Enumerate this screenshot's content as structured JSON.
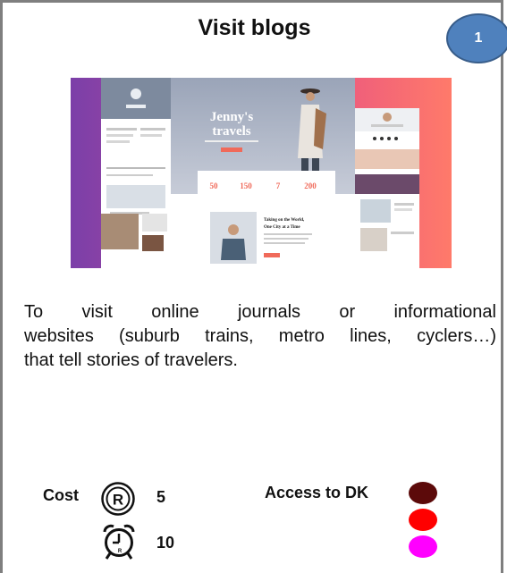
{
  "card": {
    "number": "1",
    "title": "Visit blogs",
    "description_lines": [
      "To visit online journals or informational",
      "websites (suburb trains, metro lines, cyclers…)",
      "that tell stories of travelers."
    ],
    "cost_label": "Cost",
    "cost_value": "5",
    "time_value": "10",
    "access_label": "Access to DK",
    "access_colors": [
      "#5c0a0a",
      "#ff0000",
      "#ff00ff"
    ]
  },
  "screenshot": {
    "hero_title_line1": "Jenny's",
    "hero_title_line2": "travels",
    "stats": [
      "50",
      "150",
      "7",
      "200"
    ],
    "post_title_line1": "Taking on the World,",
    "post_title_line2": "One City at a Time"
  },
  "icons": {
    "cost": "registered-coin-icon",
    "time": "alarm-clock-icon"
  }
}
